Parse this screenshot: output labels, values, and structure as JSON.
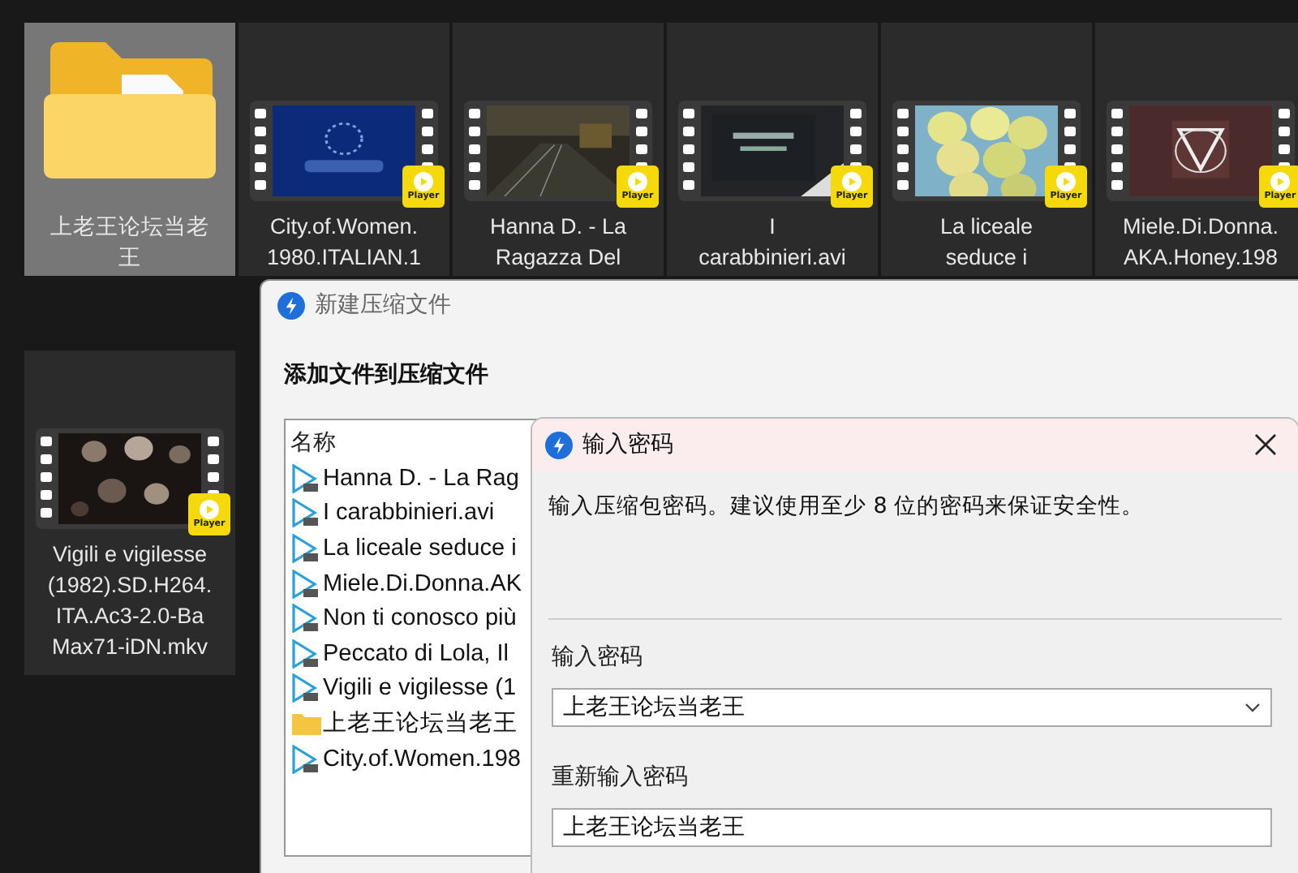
{
  "explorer": {
    "tiles": [
      {
        "kind": "folder",
        "selected": true,
        "lines": [
          "上老王论坛当老",
          "王"
        ]
      },
      {
        "kind": "video",
        "selected": false,
        "badge": "Player",
        "lines": [
          "City.of.Women.",
          "1980.ITALIAN.1"
        ]
      },
      {
        "kind": "video",
        "selected": false,
        "badge": "Player",
        "lines": [
          "Hanna D. - La",
          "Ragazza Del"
        ]
      },
      {
        "kind": "video",
        "selected": false,
        "badge": "Player",
        "lines": [
          "I",
          "carabbinieri.avi"
        ]
      },
      {
        "kind": "video",
        "selected": false,
        "badge": "Player",
        "lines": [
          "La liceale",
          "seduce i"
        ]
      },
      {
        "kind": "video",
        "selected": false,
        "badge": "Player",
        "lines": [
          "Miele.Di.Donna.",
          "AKA.Honey.198"
        ]
      },
      {
        "kind": "video",
        "selected": false,
        "badge": "Player",
        "lines": [
          "Vigili e vigilesse",
          "(1982).SD.H264.",
          "ITA.Ac3-2.0-Ba",
          "Max71-iDN.mkv"
        ]
      }
    ]
  },
  "archive_dialog": {
    "title": "新建压缩文件",
    "heading": "添加文件到压缩文件",
    "list": {
      "header": "名称",
      "items": [
        {
          "kind": "video",
          "name": "Hanna D. - La Rag"
        },
        {
          "kind": "video",
          "name": "I carabbinieri.avi"
        },
        {
          "kind": "video",
          "name": "La liceale seduce i"
        },
        {
          "kind": "video",
          "name": "Miele.Di.Donna.AK"
        },
        {
          "kind": "video",
          "name": "Non ti conosco più"
        },
        {
          "kind": "video",
          "name": "Peccato di Lola, Il"
        },
        {
          "kind": "video",
          "name": "Vigili e vigilesse (1"
        },
        {
          "kind": "folder",
          "name": "上老王论坛当老王"
        },
        {
          "kind": "video",
          "name": "City.of.Women.198"
        }
      ]
    }
  },
  "password_dialog": {
    "title": "输入密码",
    "description": "输入压缩包密码。建议使用至少 8 位的密码来保证安全性。",
    "fields": [
      {
        "kind": "dropdown",
        "label": "输入密码",
        "value": "上老王论坛当老王"
      },
      {
        "kind": "text",
        "label": "重新输入密码",
        "value": "上老王论坛当老王"
      }
    ]
  }
}
